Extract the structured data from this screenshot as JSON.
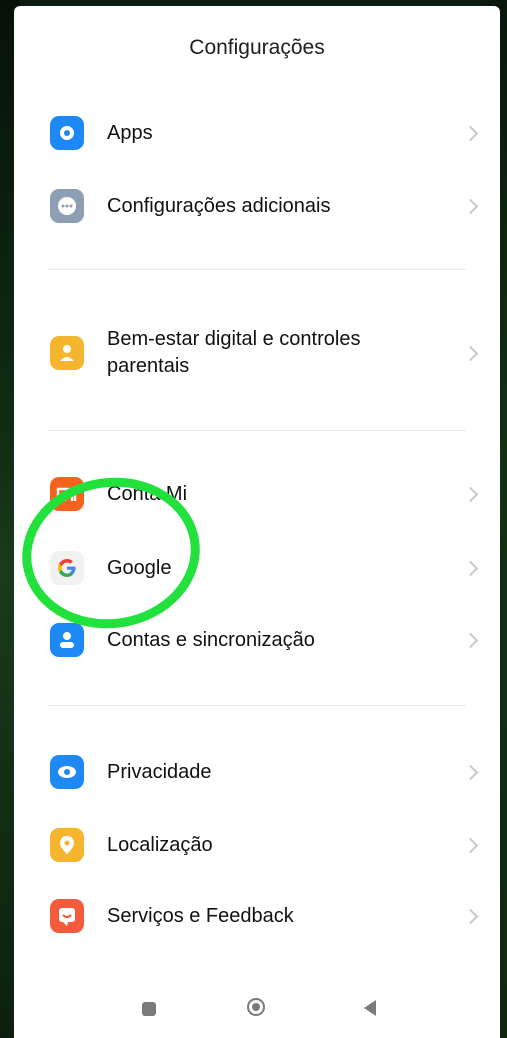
{
  "header": {
    "title": "Configurações"
  },
  "items": {
    "apps": {
      "label": "Apps",
      "icon": "gear-icon",
      "color": "#1e88f5"
    },
    "config_adicionais": {
      "label": "Configurações adicionais",
      "icon": "more-dots-icon",
      "color": "#8e9fb5"
    },
    "bem_estar": {
      "label_line1": "Bem-estar digital e controles",
      "label_line2": "parentais",
      "icon": "person-icon",
      "color": "#f6b52f"
    },
    "conta_mi": {
      "label": "Conta Mi",
      "icon": "mi-logo-icon",
      "color": "#f5621b"
    },
    "google": {
      "label": "Google",
      "icon": "google-g-icon",
      "color": "#f1f1f1"
    },
    "contas": {
      "label": "Contas e sincronização",
      "icon": "account-icon",
      "color": "#1e88f5"
    },
    "privacidade": {
      "label": "Privacidade",
      "icon": "eye-icon",
      "color": "#1e88f5"
    },
    "localizacao": {
      "label": "Localização",
      "icon": "location-pin-icon",
      "color": "#f6b52f"
    },
    "servicos": {
      "label": "Serviços e Feedback",
      "icon": "feedback-icon",
      "color": "#f45b3c"
    }
  },
  "annotation": {
    "color": "#22e13c"
  }
}
